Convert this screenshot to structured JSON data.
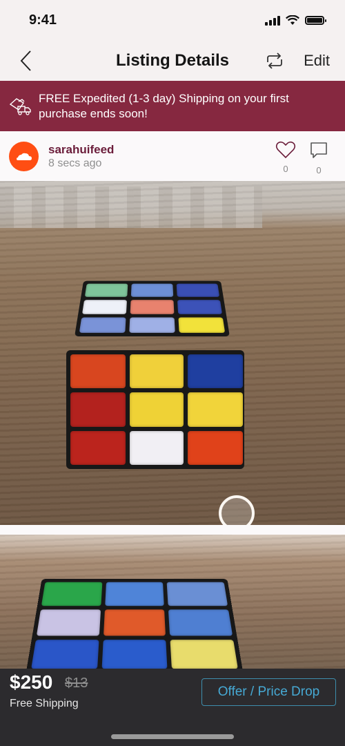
{
  "status_bar": {
    "time": "9:41"
  },
  "nav": {
    "title": "Listing Details",
    "edit_label": "Edit",
    "back_icon": "chevron-left-icon",
    "share_icon": "repost-icon"
  },
  "promo": {
    "text": "FREE Expedited (1-3 day) Shipping on your first purchase ends soon!",
    "icon": "shipping-truck-icon",
    "color": "#862840"
  },
  "seller": {
    "username": "sarahuifeed",
    "posted": "8 secs ago",
    "likes": "0",
    "comments": "0",
    "avatar_color": "#ff4e13"
  },
  "listing": {
    "photo_count": 2,
    "current_photo": 1,
    "price": "$250",
    "original_price": "$13",
    "shipping": "Free Shipping",
    "offer_label": "Offer / Price Drop",
    "accent_color": "#46a9d4"
  },
  "cube_colors": {
    "top": [
      "#7fc49a",
      "#6d8fd6",
      "#3a4fb5",
      "#eef1f8",
      "#e8826e",
      "#3c52b8",
      "#7a93d8",
      "#9fb0e6",
      "#f2e23a"
    ],
    "front": [
      "#d8461f",
      "#f0d03a",
      "#1f3fa0",
      "#b3221e",
      "#efd236",
      "#f1d43a",
      "#bb241d",
      "#f1eff4",
      "#e0421a"
    ],
    "second": [
      "#2aa64a",
      "#4f84d8",
      "#6a8fd4",
      "#c9c3e4",
      "#e05a2a",
      "#4f7fd2",
      "#2a56c8",
      "#2a5ccc",
      "#e8dc6c"
    ]
  }
}
